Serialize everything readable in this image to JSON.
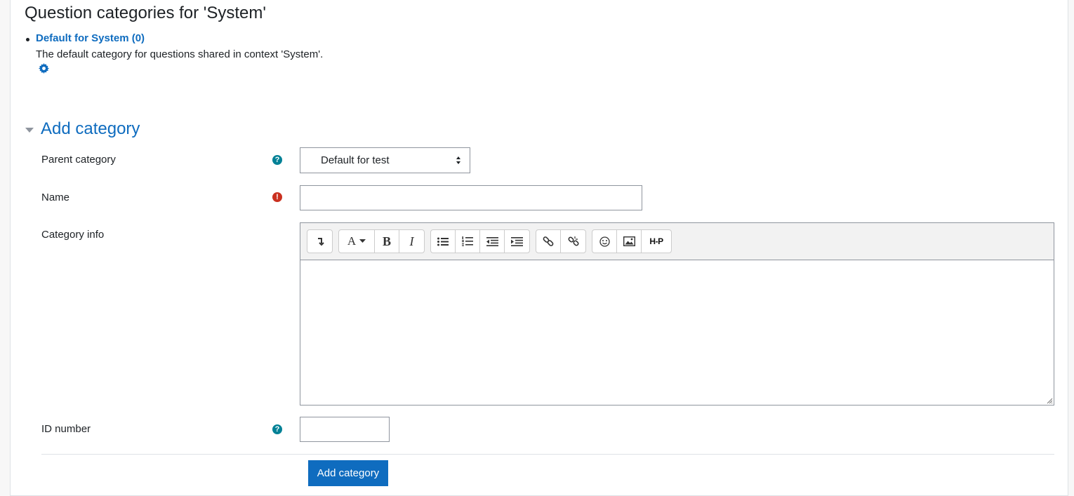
{
  "page": {
    "title": "Question categories for 'System'"
  },
  "categories": [
    {
      "link_text": "Default for System (0)",
      "description": "The default category for questions shared in context 'System'.",
      "edit_icon": "gear-icon"
    }
  ],
  "add_category": {
    "section_title": "Add category",
    "parent": {
      "label": "Parent category",
      "selected": "Default for test",
      "icon": "help-icon"
    },
    "name": {
      "label": "Name",
      "value": "",
      "icon": "required-icon"
    },
    "info": {
      "label": "Category info",
      "toolbar": [
        [
          "collapse-icon"
        ],
        [
          "font-style-icon",
          "bold-icon",
          "italic-icon"
        ],
        [
          "unordered-list-icon",
          "ordered-list-icon",
          "outdent-icon",
          "indent-icon"
        ],
        [
          "link-icon",
          "unlink-icon"
        ],
        [
          "emoticon-icon",
          "image-icon",
          "h5p-icon"
        ]
      ],
      "bold_glyph": "B",
      "italic_glyph": "I",
      "font_glyph": "A",
      "h5p_glyph": "H-P"
    },
    "idnumber": {
      "label": "ID number",
      "value": "",
      "icon": "help-icon"
    },
    "submit_label": "Add category"
  },
  "colors": {
    "link": "#0f6cbf",
    "help": "#008196",
    "required": "#ca3120",
    "primary_button": "#0f6cbf"
  }
}
